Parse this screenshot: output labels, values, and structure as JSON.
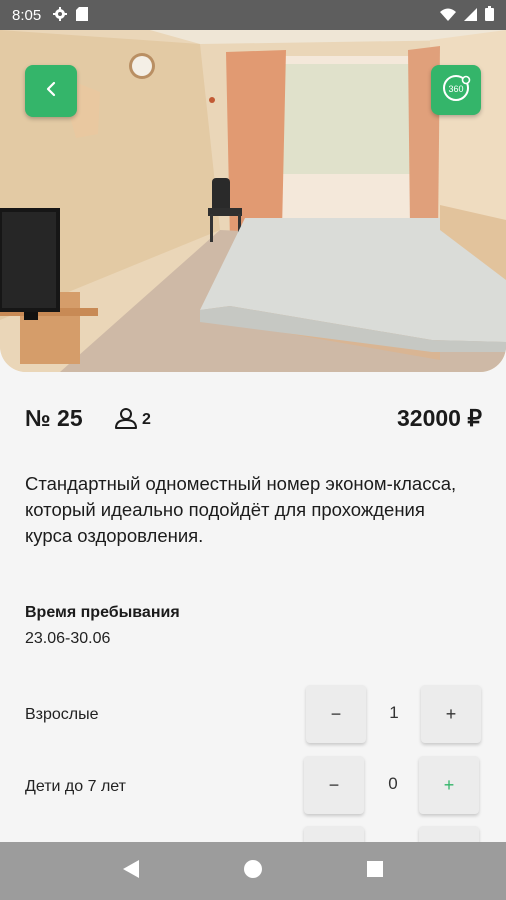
{
  "status_bar": {
    "time": "8:05",
    "icons": [
      "gear-icon",
      "sd-card-icon",
      "wifi-icon",
      "signal-icon",
      "battery-icon"
    ]
  },
  "header": {
    "back_icon": "chevron-left-icon",
    "pano_label": "360",
    "accent_color": "#34b56a"
  },
  "room": {
    "number": "№ 25",
    "guests": "2",
    "price": "32000 ₽",
    "description": "Стандартный одноместный номер эконом-класса, который идеально подойдёт для прохождения курса оздоровления."
  },
  "stay": {
    "label": "Время пребывания",
    "dates": "23.06-30.06"
  },
  "counters": [
    {
      "label": "Взрослые",
      "minus": "−",
      "value": "1",
      "plus": "+"
    },
    {
      "label": "Дети до 7 лет",
      "minus": "−",
      "value": "0",
      "plus": "+"
    }
  ],
  "nav": {
    "back": "back-triangle-icon",
    "home": "home-circle-icon",
    "recents": "recents-square-icon"
  }
}
